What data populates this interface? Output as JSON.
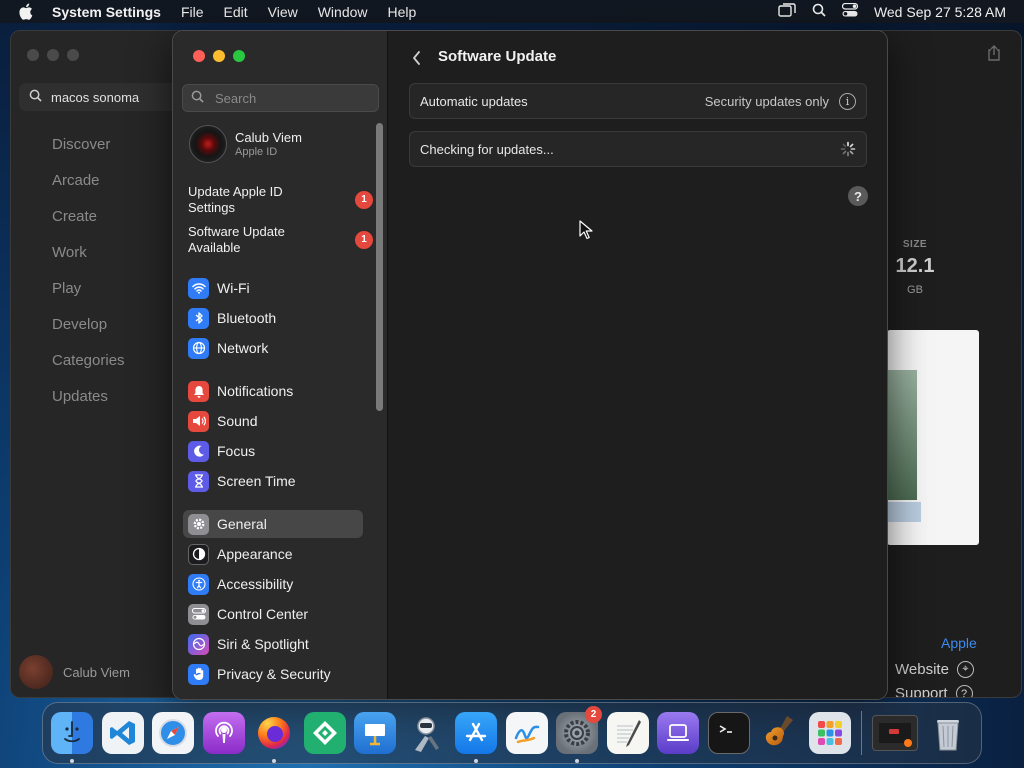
{
  "menubar": {
    "app": "System Settings",
    "items": [
      "File",
      "Edit",
      "View",
      "Window",
      "Help"
    ],
    "datetime": "Wed Sep 27  5:28 AM"
  },
  "appstore": {
    "search_value": "macos sonoma",
    "nav": [
      "Discover",
      "Arcade",
      "Create",
      "Work",
      "Play",
      "Develop",
      "Categories",
      "Updates"
    ],
    "user": "Calub Viem",
    "size_label": "SIZE",
    "size_value": "12.1",
    "size_unit": "GB",
    "developer": "Apple",
    "links": [
      "Website",
      "Support"
    ]
  },
  "settings": {
    "search_placeholder": "Search",
    "profile": {
      "name": "Calub Viem",
      "sub": "Apple ID"
    },
    "notices": [
      {
        "label": "Update Apple ID Settings",
        "badge": "1"
      },
      {
        "label": "Software Update Available",
        "badge": "1"
      }
    ],
    "nav": [
      {
        "label": "Wi-Fi",
        "icon": "wifi-icon",
        "color": "#2f7cf6"
      },
      {
        "label": "Bluetooth",
        "icon": "bluetooth-icon",
        "color": "#2f7cf6"
      },
      {
        "label": "Network",
        "icon": "globe-icon",
        "color": "#2f7cf6"
      },
      {
        "label": "Notifications",
        "icon": "bell-icon",
        "color": "#e5483c"
      },
      {
        "label": "Sound",
        "icon": "speaker-icon",
        "color": "#e5483c"
      },
      {
        "label": "Focus",
        "icon": "moon-icon",
        "color": "#5e5ce6"
      },
      {
        "label": "Screen Time",
        "icon": "hourglass-icon",
        "color": "#5e5ce6"
      },
      {
        "label": "General",
        "icon": "gear-icon",
        "color": "#8e8e93"
      },
      {
        "label": "Appearance",
        "icon": "appearance-icon",
        "color": "#1c1c1e"
      },
      {
        "label": "Accessibility",
        "icon": "accessibility-icon",
        "color": "#2f7cf6"
      },
      {
        "label": "Control Center",
        "icon": "control-center-icon",
        "color": "#8e8e93"
      },
      {
        "label": "Siri & Spotlight",
        "icon": "siri-icon",
        "color": "#b04bd8"
      },
      {
        "label": "Privacy & Security",
        "icon": "hand-icon",
        "color": "#2f7cf6"
      }
    ],
    "selected": "General",
    "main": {
      "title": "Software Update",
      "auto_label": "Automatic updates",
      "auto_value": "Security updates only",
      "checking": "Checking for updates...",
      "help": "?"
    }
  },
  "dock": {
    "apps": [
      {
        "name": "finder-icon",
        "color": "#3a8ee6",
        "running": true
      },
      {
        "name": "vscode-icon",
        "color": "#1f6fc0",
        "running": false
      },
      {
        "name": "safari-icon",
        "color": "#e8eef5",
        "running": false
      },
      {
        "name": "podcasts-icon",
        "color": "#a246d6",
        "running": false
      },
      {
        "name": "firefox-icon",
        "color": "#7a3fd0",
        "running": true
      },
      {
        "name": "office-icon",
        "color": "#21a86a",
        "running": false
      },
      {
        "name": "keynote-icon",
        "color": "#2a8ae0",
        "running": false
      },
      {
        "name": "automator-icon",
        "color": "#d0d4da",
        "running": false
      },
      {
        "name": "app-store-icon",
        "color": "#1e8cf0",
        "running": true
      },
      {
        "name": "freeform-icon",
        "color": "#f4f6f8",
        "running": false
      },
      {
        "name": "system-settings-icon",
        "color": "#8e8e93",
        "running": true,
        "badge": "2"
      },
      {
        "name": "textedit-icon",
        "color": "#f2f2f2",
        "running": false
      },
      {
        "name": "podcast-studio-icon",
        "color": "#7c5ce0",
        "running": false
      },
      {
        "name": "terminal-icon",
        "color": "#1a1a1a",
        "running": false
      },
      {
        "name": "garageband-icon",
        "color": "#3a3a3a",
        "running": false
      },
      {
        "name": "launchpad-icon",
        "color": "#d8dde4",
        "running": false
      }
    ],
    "extras": [
      {
        "name": "window-preview-icon",
        "color": "#2a2a2a"
      },
      {
        "name": "trash-icon",
        "color": "#9aa2ac"
      }
    ]
  }
}
